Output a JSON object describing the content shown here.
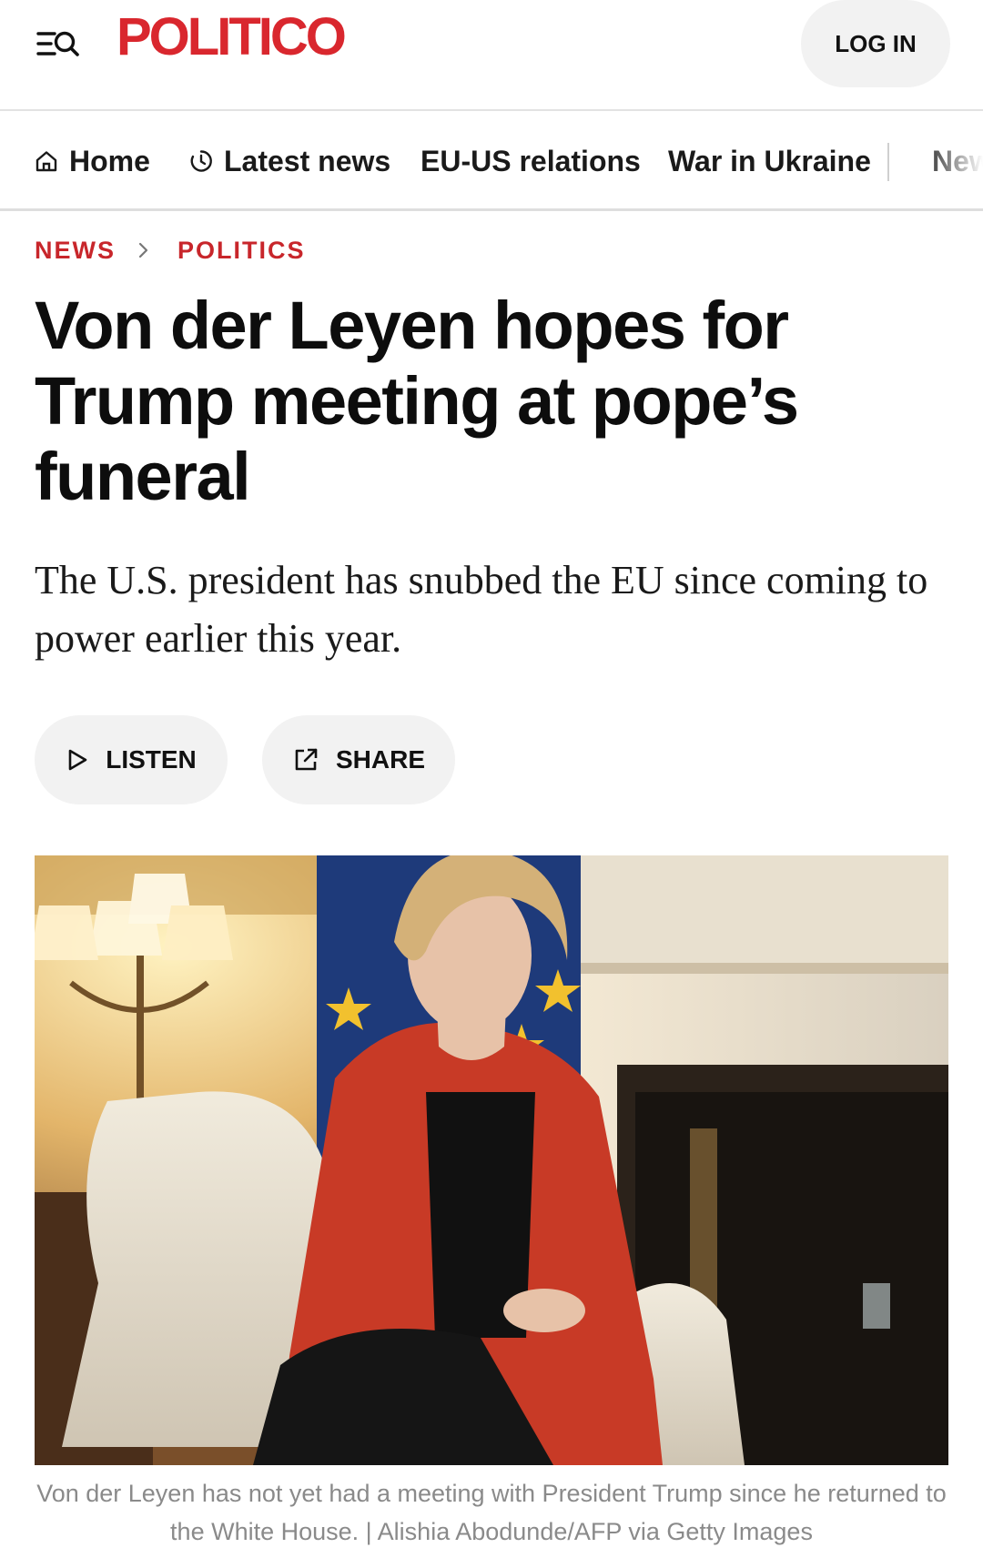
{
  "header": {
    "logo_text": "POLITICO",
    "login_label": "LOG IN",
    "menu_icon": "menu-search-icon"
  },
  "nav": {
    "items": [
      {
        "label": "Home",
        "icon": "home-icon"
      },
      {
        "label": "Latest news",
        "icon": "clock-icon"
      },
      {
        "label": "EU-US relations"
      },
      {
        "label": "War in Ukraine"
      },
      {
        "label": "New"
      }
    ]
  },
  "breadcrumb": {
    "section": "NEWS",
    "subsection": "POLITICS"
  },
  "article": {
    "headline": "Von der Leyen hopes for Trump meeting at pope’s funeral",
    "dek": "The U.S. president has snubbed the EU since coming to power earlier this year.",
    "listen_label": "LISTEN",
    "share_label": "SHARE",
    "caption": "Von der Leyen has not yet had a meeting with President Trump since he returned to the White House. | Alishia Abodunde/AFP via Getty Images"
  },
  "colors": {
    "brand": "#d9272e",
    "breadcrumb": "#c8262b",
    "pill_bg": "#f2f2f2",
    "caption": "#8a8a8a"
  }
}
